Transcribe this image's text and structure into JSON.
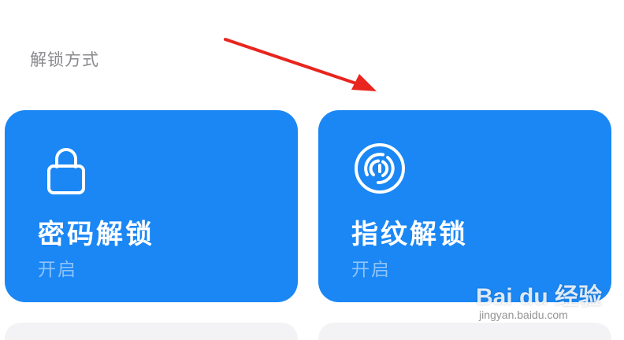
{
  "section": {
    "title": "解锁方式"
  },
  "cards": [
    {
      "title": "密码解锁",
      "status": "开启",
      "icon": "lock-icon"
    },
    {
      "title": "指纹解锁",
      "status": "开启",
      "icon": "fingerprint-icon"
    }
  ],
  "colors": {
    "card_bg": "#1a87f5",
    "card_title": "#ffffff",
    "card_status": "#8fc3f8",
    "section_title": "#8a8a8e",
    "annotation_arrow": "#e8251e"
  },
  "watermark": {
    "logo": "Bai du 经验",
    "url": "jingyan.baidu.com"
  }
}
